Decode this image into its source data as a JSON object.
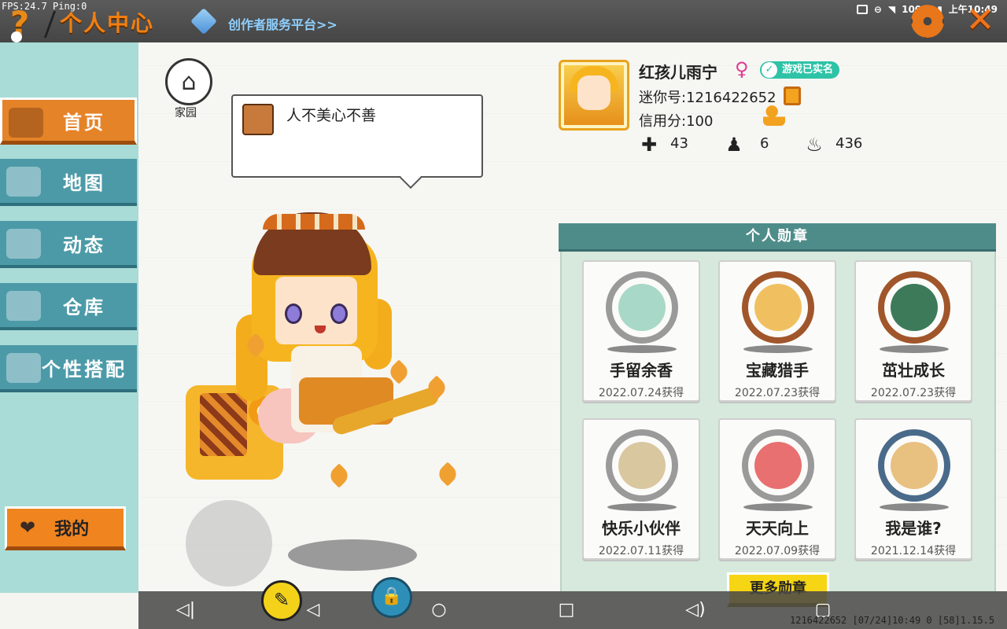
{
  "status_bar": {
    "fps": "FPS:24.7",
    "ping": "Ping:0",
    "battery": "100%",
    "time": "上午10:49"
  },
  "header": {
    "help_glyph": "?",
    "title": "个人中心",
    "creator_link": "创作者服务平台>>",
    "close_glyph": "✕"
  },
  "sidebar": {
    "items": [
      {
        "label": "首页",
        "icon": "house-icon",
        "active": true
      },
      {
        "label": "地图",
        "icon": "map-icon",
        "active": false
      },
      {
        "label": "动态",
        "icon": "bell-icon",
        "active": false
      },
      {
        "label": "仓库",
        "icon": "box-icon",
        "active": false
      },
      {
        "label": "个性搭配",
        "icon": "outfit-icon",
        "active": false
      }
    ],
    "mine_button": "我的",
    "heart_glyph": "❤"
  },
  "home": {
    "label": "家园",
    "icon_glyph": "⌂"
  },
  "speech_bubble": {
    "text": "人不美心不善"
  },
  "profile": {
    "nickname": "红孩儿雨宁",
    "gender_glyph": "♀",
    "verified_badge": "游戏已实名",
    "mini_id": "迷你号:1216422652",
    "credit_score": "信用分:100",
    "stats": [
      {
        "icon": "bookmark-plus-icon",
        "glyph": "✚",
        "value": "43"
      },
      {
        "icon": "fans-icon",
        "glyph": "♟",
        "value": "6"
      },
      {
        "icon": "flame-icon",
        "glyph": "♨",
        "value": "436"
      }
    ]
  },
  "medals": {
    "title": "个人勋章",
    "items": [
      {
        "name": "手留余香",
        "date": "2022.07.24获得",
        "ring_color": "#9a9a9a",
        "inner_color": "#a8d8c8"
      },
      {
        "name": "宝藏猎手",
        "date": "2022.07.23获得",
        "ring_color": "#a0562a",
        "inner_color": "#f0c060"
      },
      {
        "name": "茁壮成长",
        "date": "2022.07.23获得",
        "ring_color": "#a0562a",
        "inner_color": "#3d7a5a"
      },
      {
        "name": "快乐小伙伴",
        "date": "2022.07.11获得",
        "ring_color": "#9a9a9a",
        "inner_color": "#d9c7a0"
      },
      {
        "name": "天天向上",
        "date": "2022.07.09获得",
        "ring_color": "#9a9a9a",
        "inner_color": "#e87070"
      },
      {
        "name": "我是谁?",
        "date": "2021.12.14获得",
        "ring_color": "#4a6a8a",
        "inner_color": "#e8c080"
      }
    ],
    "more_button": "更多勋章"
  },
  "debug": {
    "line": "1216422652   [07/24]10:49 0  [58]1.15.5"
  },
  "colors": {
    "accent_orange": "#e58328",
    "sidebar_teal": "#4c9aa8",
    "medal_header": "#4e8c8a",
    "more_button_yellow": "#f6d514"
  }
}
